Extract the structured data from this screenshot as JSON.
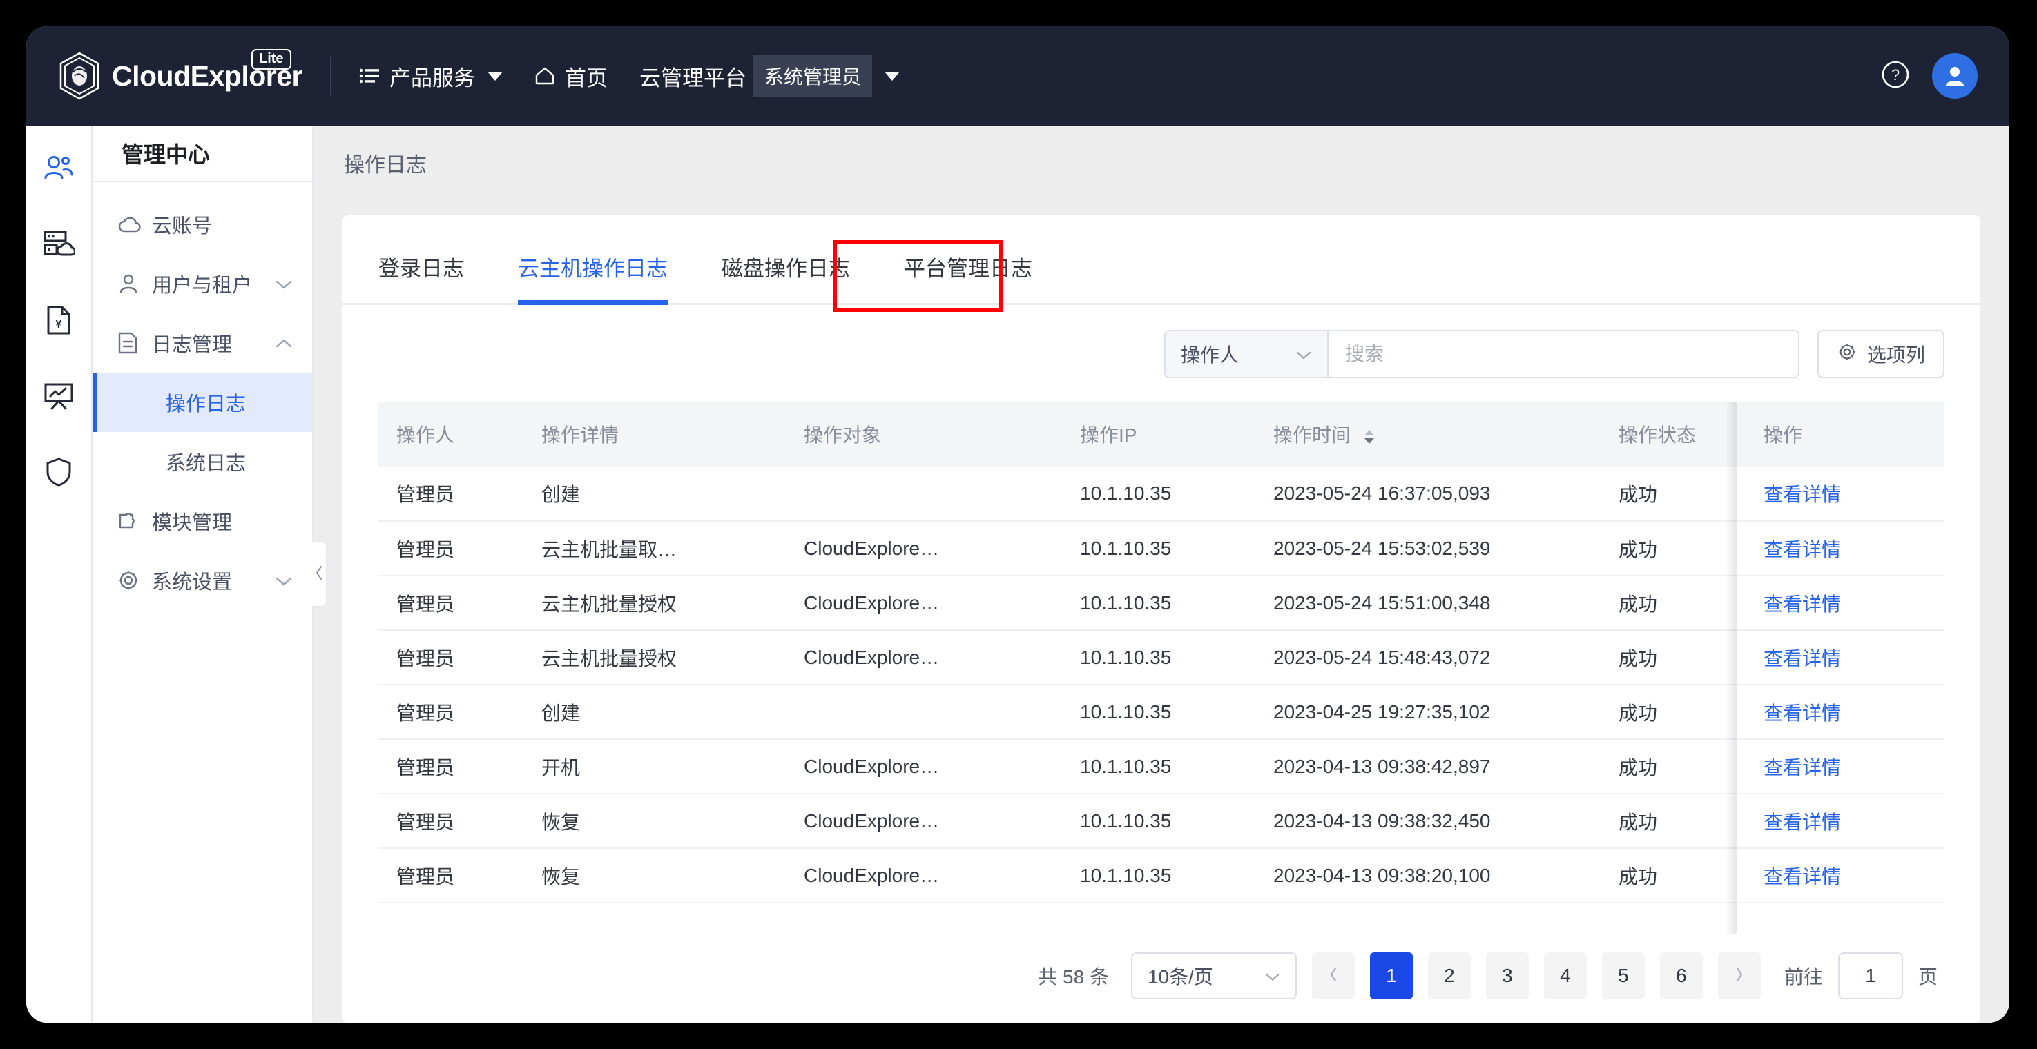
{
  "brand": {
    "name": "CloudExplorer",
    "badge": "Lite",
    "logo_icon": "hexagon-cloud-logo-icon"
  },
  "topnav": {
    "items": [
      {
        "label": "产品服务",
        "icon": "menu-list-icon",
        "has_caret": true
      },
      {
        "label": "首页",
        "icon": "home-icon",
        "has_caret": false
      }
    ],
    "platform_label": "云管理平台",
    "role_chip": "系统管理员",
    "help_icon": "question-circle-icon",
    "avatar_icon": "user-avatar-icon"
  },
  "icon_rail": {
    "items": [
      {
        "name": "users-icon",
        "active": true
      },
      {
        "name": "server-cloud-icon",
        "active": false
      },
      {
        "name": "billing-yen-document-icon",
        "active": false
      },
      {
        "name": "report-chart-icon",
        "active": false
      },
      {
        "name": "shield-security-icon",
        "active": false
      }
    ]
  },
  "sidebar": {
    "title": "管理中心",
    "items": [
      {
        "label": "云账号",
        "icon": "cloud-icon",
        "chevron": "none",
        "type": "item"
      },
      {
        "label": "用户与租户",
        "icon": "user-icon",
        "chevron": "down",
        "type": "item"
      },
      {
        "label": "日志管理",
        "icon": "log-document-icon",
        "chevron": "up",
        "type": "item"
      },
      {
        "label": "操作日志",
        "type": "sub",
        "active": true
      },
      {
        "label": "系统日志",
        "type": "sub",
        "active": false
      },
      {
        "label": "模块管理",
        "icon": "puzzle-icon",
        "chevron": "none",
        "type": "item"
      },
      {
        "label": "系统设置",
        "icon": "gear-icon",
        "chevron": "down",
        "type": "item"
      }
    ],
    "collapse_icon": "chevron-left-icon"
  },
  "breadcrumb": "操作日志",
  "tabs": [
    {
      "label": "登录日志",
      "active": false
    },
    {
      "label": "云主机操作日志",
      "active": true,
      "highlighted": true
    },
    {
      "label": "磁盘操作日志",
      "active": false
    },
    {
      "label": "平台管理日志",
      "active": false
    }
  ],
  "toolbar": {
    "filter_select_value": "操作人",
    "filter_select_icon": "chevron-down-icon",
    "search_placeholder": "搜索",
    "search_value": "",
    "columns_button_label": "选项列",
    "columns_button_icon": "gear-icon"
  },
  "table": {
    "headers": [
      "操作人",
      "操作详情",
      "操作对象",
      "操作IP",
      "操作时间",
      "操作状态",
      "操作"
    ],
    "sortable_header": "操作时间",
    "sort_icon": "sort-updown-icon",
    "action_link_label": "查看详情",
    "rows": [
      {
        "operator": "管理员",
        "detail": "创建",
        "target": "",
        "ip": "10.1.10.35",
        "time": "2023-05-24 16:37:05,093",
        "status": "成功",
        "action": "查看详情"
      },
      {
        "operator": "管理员",
        "detail": "云主机批量取…",
        "target": "CloudExplore…",
        "ip": "10.1.10.35",
        "time": "2023-05-24 15:53:02,539",
        "status": "成功",
        "action": "查看详情"
      },
      {
        "operator": "管理员",
        "detail": "云主机批量授权",
        "target": "CloudExplore…",
        "ip": "10.1.10.35",
        "time": "2023-05-24 15:51:00,348",
        "status": "成功",
        "action": "查看详情"
      },
      {
        "operator": "管理员",
        "detail": "云主机批量授权",
        "target": "CloudExplore…",
        "ip": "10.1.10.35",
        "time": "2023-05-24 15:48:43,072",
        "status": "成功",
        "action": "查看详情"
      },
      {
        "operator": "管理员",
        "detail": "创建",
        "target": "",
        "ip": "10.1.10.35",
        "time": "2023-04-25 19:27:35,102",
        "status": "成功",
        "action": "查看详情"
      },
      {
        "operator": "管理员",
        "detail": "开机",
        "target": "CloudExplore…",
        "ip": "10.1.10.35",
        "time": "2023-04-13 09:38:42,897",
        "status": "成功",
        "action": "查看详情"
      },
      {
        "operator": "管理员",
        "detail": "恢复",
        "target": "CloudExplore…",
        "ip": "10.1.10.35",
        "time": "2023-04-13 09:38:32,450",
        "status": "成功",
        "action": "查看详情"
      },
      {
        "operator": "管理员",
        "detail": "恢复",
        "target": "CloudExplore…",
        "ip": "10.1.10.35",
        "time": "2023-04-13 09:38:20,100",
        "status": "成功",
        "action": "查看详情"
      }
    ]
  },
  "pagination": {
    "total_label": "共 58 条",
    "page_size_label": "10条/页",
    "prev_icon": "chevron-left-icon",
    "next_icon": "chevron-right-icon",
    "pages": [
      "1",
      "2",
      "3",
      "4",
      "5",
      "6"
    ],
    "current_page": "1",
    "goto_label": "前往",
    "goto_value": "1",
    "page_unit": "页"
  },
  "colors": {
    "topbar_bg": "#1d2235",
    "accent_blue": "#2563eb",
    "pagination_active": "#1a49e8",
    "highlight_red": "#ff0000",
    "sidebar_active_bg": "#e3eafd"
  }
}
